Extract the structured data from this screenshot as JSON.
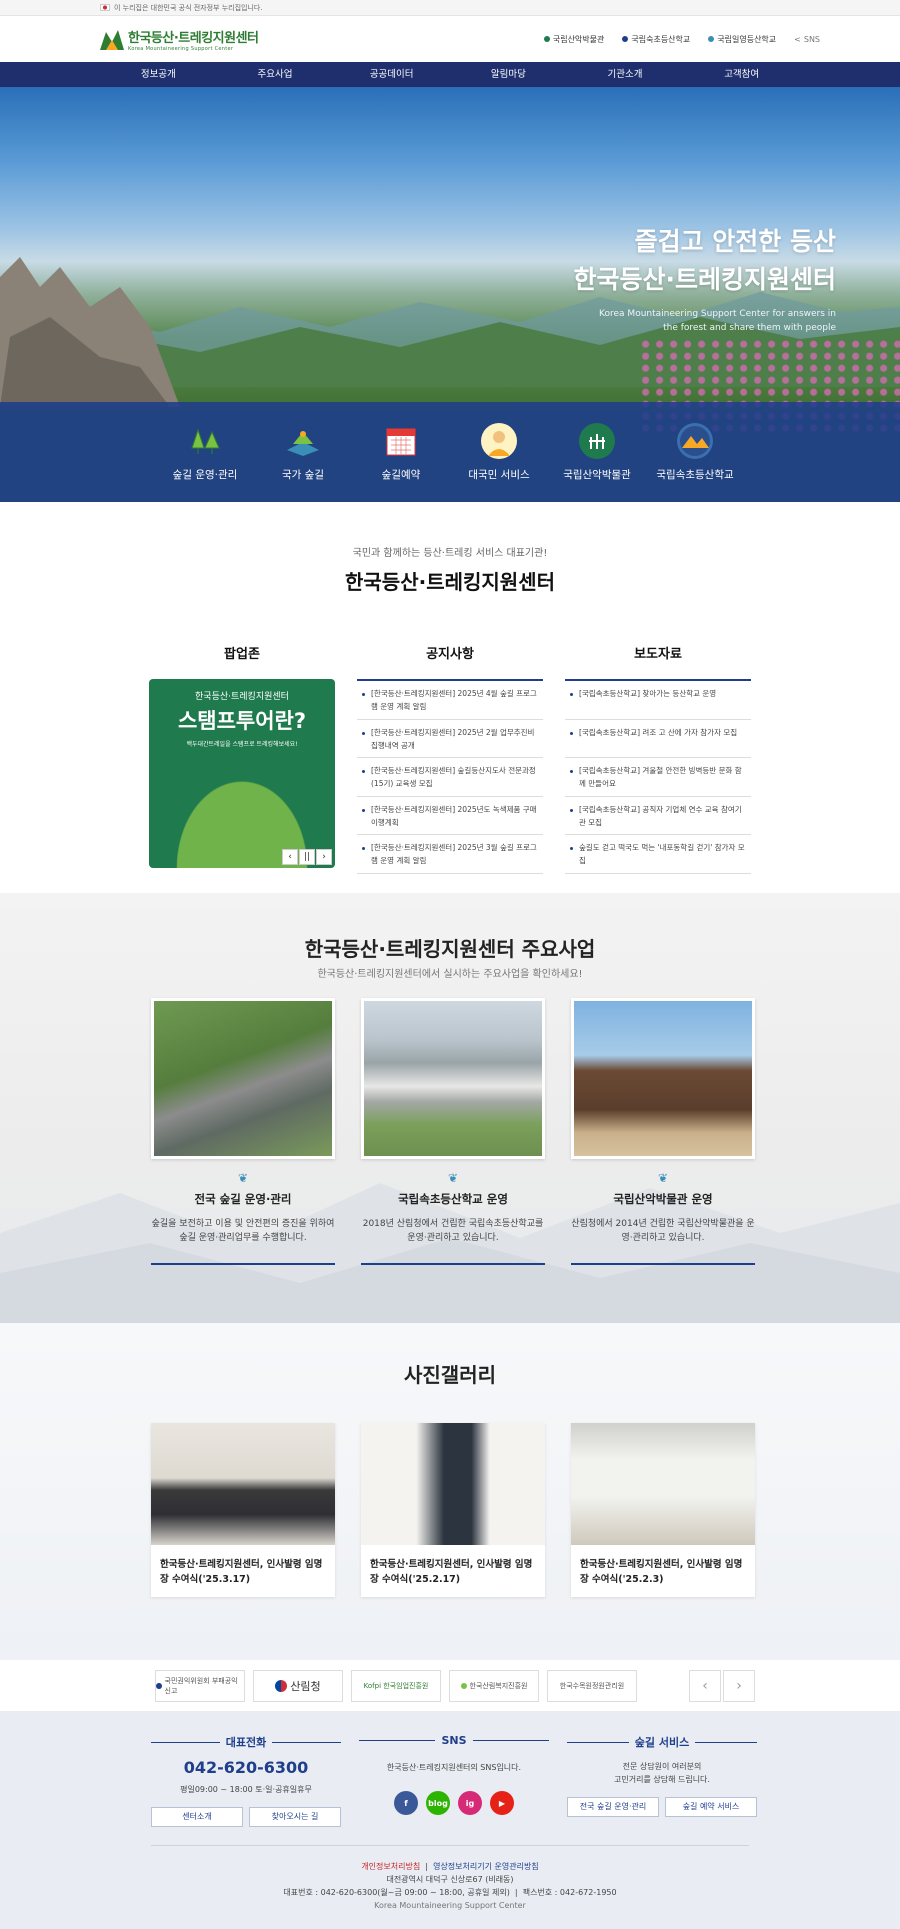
{
  "gov_banner": {
    "text": "이 누리집은 대한민국 공식 전자정부 누리집입니다."
  },
  "logo": {
    "title": "한국등산·트레킹지원센터",
    "subtitle": "Korea Mountaineering Support Center"
  },
  "util_links": [
    {
      "label": "국립산악박물관",
      "color": "#1f7a4d"
    },
    {
      "label": "국립숙초등산학교",
      "color": "#1f3f8c"
    },
    {
      "label": "국립일영등산학교",
      "color": "#3a8fb7"
    },
    {
      "label": "SNS",
      "color": "#999999"
    }
  ],
  "gnb": [
    "정보공개",
    "주요사업",
    "공공데이터",
    "알림마당",
    "기관소개",
    "고객참여"
  ],
  "hero": {
    "title_line1": "즐겁고 안전한 등산",
    "title_line2": "한국등산·트레킹지원센터",
    "subtitle": "Korea Mountaineering Support Center for answers in the forest and share them with people"
  },
  "quick_menu": [
    {
      "label": "숲길 운영·관리",
      "icon": "tree-icon"
    },
    {
      "label": "국가 숲길",
      "icon": "map-icon"
    },
    {
      "label": "숲길예약",
      "icon": "calendar-icon"
    },
    {
      "label": "대국민 서비스",
      "icon": "person-icon"
    },
    {
      "label": "국립산악박물관",
      "icon": "museum-icon"
    },
    {
      "label": "국립속초등산학교",
      "icon": "school-icon"
    }
  ],
  "intro": {
    "subtitle": "국민과 함께하는 등산·트레킹 서비스 대표기관!",
    "title": "한국등산·트레킹지원센터"
  },
  "popup": {
    "heading": "팝업존",
    "line1": "한국등산·트레킹지원센터",
    "line2": "스탬프투어란?",
    "line3": "백두대간트레일을 스탬프로 트레킹해보세요!",
    "controls": [
      "‹",
      "||",
      "›"
    ]
  },
  "notices": {
    "heading": "공지사항",
    "items": [
      "[한국등산·트레킹지원센터] 2025년 4월 숲길 프로그램 운영 계획 알림",
      "[한국등산·트레킹지원센터] 2025년 2월 업무추진비 집행내역 공개",
      "[한국등산·트레킹지원센터] 숲길등산지도사 전문과정(15기) 교육생 모집",
      "[한국등산·트레킹지원센터] 2025년도 녹색제품 구매이행계획",
      "[한국등산·트레킹지원센터] 2025년 3월 숲길 프로그램 운영 계획 알림"
    ]
  },
  "press": {
    "heading": "보도자료",
    "items": [
      "[국립속초등산학교] 찾아가는 등산학교 운영",
      "[국립속초등산학교] 려조 고 산에 가자 참가자 모집",
      "[국립속초등산학교] 겨울철 안전한 빙벽등반 문화 함께 만들어요",
      "[국립속초등산학교] 공직자 기업체 연수 교육 참여기관 모집",
      "숲길도 걷고 떡국도 먹는 '내포동학길 걷기' 참가자 모집"
    ]
  },
  "business": {
    "title": "한국등산·트레킹지원센터 주요사업",
    "subtitle": "한국등산·트레킹지원센터에서 실시하는 주요사업을 확인하세요!",
    "cards": [
      {
        "title": "전국 숲길 운영·관리",
        "desc": "숲길을 보전하고 이용 및 안전편의 증진을 위하여 숲길 운영·관리업무를 수행합니다."
      },
      {
        "title": "국립속초등산학교 운영",
        "desc": "2018년 산림청에서 건립한 국립속초등산학교를 운영·관리하고 있습니다."
      },
      {
        "title": "국립산악박물관 운영",
        "desc": "산림청에서 2014년 건립한 국립산악박물관을 운영·관리하고 있습니다."
      }
    ]
  },
  "gallery": {
    "title": "사진갤러리",
    "cards": [
      {
        "caption": "한국등산·트레킹지원센터, 인사발령 임명장 수여식('25.3.17)"
      },
      {
        "caption": "한국등산·트레킹지원센터, 인사발령 임명장 수여식('25.2.17)"
      },
      {
        "caption": "한국등산·트레킹지원센터, 인사발령 임명장 수여식('25.2.3)"
      }
    ]
  },
  "partners": [
    "국민권익위원회 부패공익신고",
    "산림청",
    "Kofpi 한국임업진흥원",
    "한국산림복지진흥원",
    "한국수목원정원관리원"
  ],
  "partner_nav": [
    "‹",
    "›"
  ],
  "footer": {
    "phone_heading": "대표전화",
    "phone": "042-620-6300",
    "phone_hours": "평일09:00 ~ 18:00 토·일·공휴일휴무",
    "phone_buttons": [
      "센터소개",
      "찾아오시는 길"
    ],
    "sns_heading": "SNS",
    "sns_text": "한국등산·트레킹지원센터의 SNS입니다.",
    "sns": [
      {
        "label": "f",
        "color": "#3b5998"
      },
      {
        "label": "blog",
        "color": "#2db400"
      },
      {
        "label": "ig",
        "color": "#d62976"
      },
      {
        "label": "▶",
        "color": "#e62117"
      }
    ],
    "service_heading": "숲길 서비스",
    "service_text1": "전문 상담원이 여러분의",
    "service_text2": "고민거리를 상담해 드립니다.",
    "service_buttons": [
      "전국 숲길 운영·관리",
      "숲길 예약 서비스"
    ],
    "privacy": "개인정보처리방침",
    "cctv": "영상정보처리기기 운영관리방침",
    "address": "대전광역시 대덕구 신상로67 (비래동)",
    "tel": "대표번호 : 042-620-6300(월~금 09:00 ~ 18:00, 공휴일 제외)",
    "fax": "팩스번호 : 042-672-1950",
    "copyright": "Korea Mountaineering Support Center"
  }
}
